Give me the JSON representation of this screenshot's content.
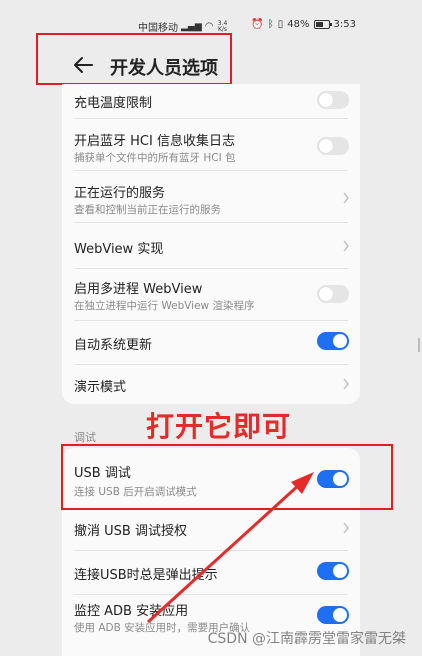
{
  "status_bar": {
    "carrier": "中国移动",
    "signal": "4G",
    "speed_top": "3.4",
    "speed_bottom": "K/s",
    "battery": "48%",
    "time": "3:53"
  },
  "header": {
    "title": "开发人员选项"
  },
  "settings": {
    "charge_temp": {
      "title": "充电温度限制",
      "toggle": "off"
    },
    "bt_hci": {
      "title": "开启蓝牙 HCI 信息收集日志",
      "subtitle": "捕获单个文件中的所有蓝牙 HCI 包",
      "toggle": "off"
    },
    "running_services": {
      "title": "正在运行的服务",
      "subtitle": "查看和控制当前正在运行的服务"
    },
    "webview_impl": {
      "title": "WebView 实现"
    },
    "multiprocess_webview": {
      "title": "启用多进程 WebView",
      "subtitle": "在独立进程中运行 WebView 渲染程序",
      "toggle": "off"
    },
    "auto_update": {
      "title": "自动系统更新",
      "toggle": "on"
    },
    "demo_mode": {
      "title": "演示模式"
    }
  },
  "debug_section": {
    "label": "调试",
    "usb_debugging": {
      "title": "USB 调试",
      "subtitle": "连接 USB 后开启调试模式",
      "toggle": "on"
    },
    "revoke_usb": {
      "title": "撤消 USB 调试授权"
    },
    "usb_prompt": {
      "title": "连接USB时总是弹出提示",
      "toggle": "on"
    },
    "adb_monitor": {
      "title": "监控 ADB 安装应用",
      "subtitle": "使用 ADB 安装应用时，需要用户确认",
      "toggle": "on"
    }
  },
  "annotation": {
    "text": "打开它即可",
    "color": "#e52a2a"
  },
  "watermark": "CSDN @江南霹雳堂雷家雷无桀",
  "colors": {
    "accent": "#1e6ff2",
    "highlight": "#e02020"
  }
}
